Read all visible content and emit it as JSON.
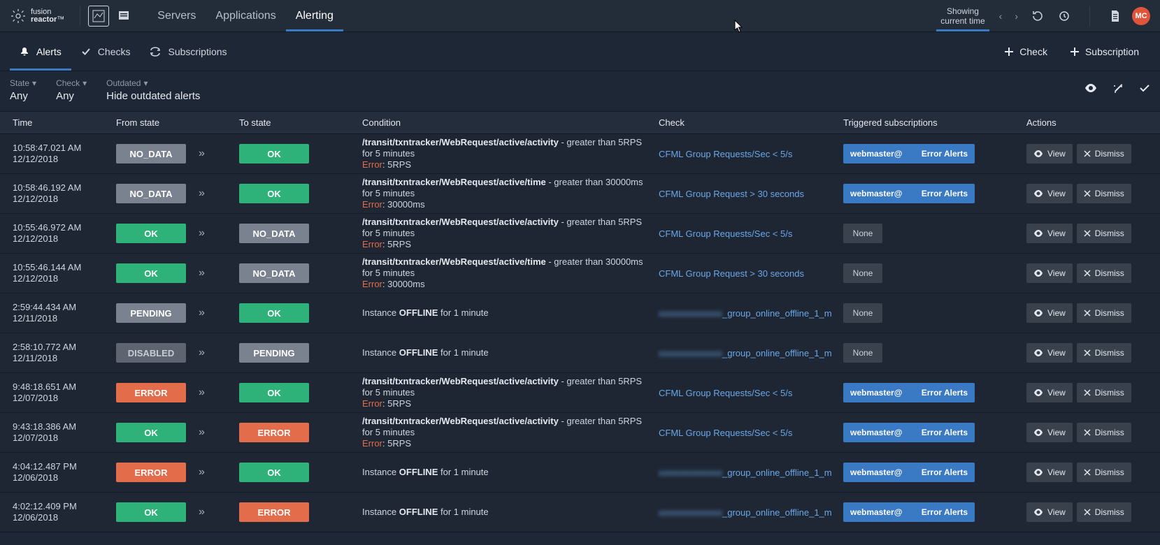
{
  "brand": {
    "name1": "fusion",
    "name2": "reactor",
    "tm": "™"
  },
  "nav": {
    "servers": "Servers",
    "applications": "Applications",
    "alerting": "Alerting"
  },
  "time": {
    "l1": "Showing",
    "l2": "current time"
  },
  "avatar": "MC",
  "subtabs": {
    "alerts": "Alerts",
    "checks": "Checks",
    "subscriptions": "Subscriptions"
  },
  "subbtn": {
    "check": "Check",
    "subscription": "Subscription"
  },
  "filters": {
    "state": {
      "label": "State",
      "value": "Any"
    },
    "check": {
      "label": "Check",
      "value": "Any"
    },
    "outdated": {
      "label": "Outdated",
      "value": "Hide outdated alerts"
    }
  },
  "columns": {
    "time": "Time",
    "from": "From state",
    "to": "To state",
    "cond": "Condition",
    "check": "Check",
    "trig": "Triggered subscriptions",
    "actions": "Actions"
  },
  "labels": {
    "view": "View",
    "dismiss": "Dismiss",
    "none": "None",
    "sub_left": "webmaster@",
    "sub_right": "Error Alerts",
    "error": "Error",
    "offline": "OFFLINE",
    "instance": "Instance",
    " for1": " for 1 minute"
  },
  "rows": [
    {
      "t1": "10:58:47.021 AM",
      "t2": "12/12/2018",
      "from": "NO_DATA",
      "to": "OK",
      "cond_path": "/transit/txntracker/WebRequest/active/activity",
      "cond_rest": " - greater than 5RPS for 5 minutes",
      "cond_err": ": 5RPS",
      "check": "CFML Group Requests/Sec < 5/s",
      "sub": "pill",
      "blur": false
    },
    {
      "t1": "10:58:46.192 AM",
      "t2": "12/12/2018",
      "from": "NO_DATA",
      "to": "OK",
      "cond_path": "/transit/txntracker/WebRequest/active/time",
      "cond_rest": " - greater than 30000ms for 5 minutes",
      "cond_err": ": 30000ms",
      "check": "CFML Group Request > 30 seconds",
      "sub": "pill",
      "blur": false
    },
    {
      "t1": "10:55:46.972 AM",
      "t2": "12/12/2018",
      "from": "OK",
      "to": "NO_DATA",
      "cond_path": "/transit/txntracker/WebRequest/active/activity",
      "cond_rest": " - greater than 5RPS for 5 minutes",
      "cond_err": ": 5RPS",
      "check": "CFML Group Requests/Sec < 5/s",
      "sub": "none",
      "blur": false
    },
    {
      "t1": "10:55:46.144 AM",
      "t2": "12/12/2018",
      "from": "OK",
      "to": "NO_DATA",
      "cond_path": "/transit/txntracker/WebRequest/active/time",
      "cond_rest": " - greater than 30000ms for 5 minutes",
      "cond_err": ": 30000ms",
      "check": "CFML Group Request > 30 seconds",
      "sub": "none",
      "blur": false
    },
    {
      "t1": "2:59:44.434 AM",
      "t2": "12/11/2018",
      "from": "PENDING",
      "to": "OK",
      "cond_offline": true,
      "check": "_group_online_offline_1_m",
      "sub": "none",
      "blur": true
    },
    {
      "t1": "2:58:10.772 AM",
      "t2": "12/11/2018",
      "from": "DISABLED",
      "to": "PENDING",
      "cond_offline": true,
      "check": "_group_online_offline_1_m",
      "sub": "none",
      "blur": true
    },
    {
      "t1": "9:48:18.651 AM",
      "t2": "12/07/2018",
      "from": "ERROR",
      "to": "OK",
      "cond_path": "/transit/txntracker/WebRequest/active/activity",
      "cond_rest": " - greater than 5RPS for 5 minutes",
      "cond_err": ": 5RPS",
      "check": "CFML Group Requests/Sec < 5/s",
      "sub": "pill",
      "blur": false
    },
    {
      "t1": "9:43:18.386 AM",
      "t2": "12/07/2018",
      "from": "OK",
      "to": "ERROR",
      "cond_path": "/transit/txntracker/WebRequest/active/activity",
      "cond_rest": " - greater than 5RPS for 5 minutes",
      "cond_err": ": 5RPS",
      "check": "CFML Group Requests/Sec < 5/s",
      "sub": "pill",
      "blur": false
    },
    {
      "t1": "4:04:12.487 PM",
      "t2": "12/06/2018",
      "from": "ERROR",
      "to": "OK",
      "cond_offline": true,
      "check": "_group_online_offline_1_m",
      "sub": "pill",
      "blur": true
    },
    {
      "t1": "4:02:12.409 PM",
      "t2": "12/06/2018",
      "from": "OK",
      "to": "ERROR",
      "cond_offline": true,
      "check": "_group_online_offline_1_m",
      "sub": "pill",
      "blur": true
    }
  ]
}
